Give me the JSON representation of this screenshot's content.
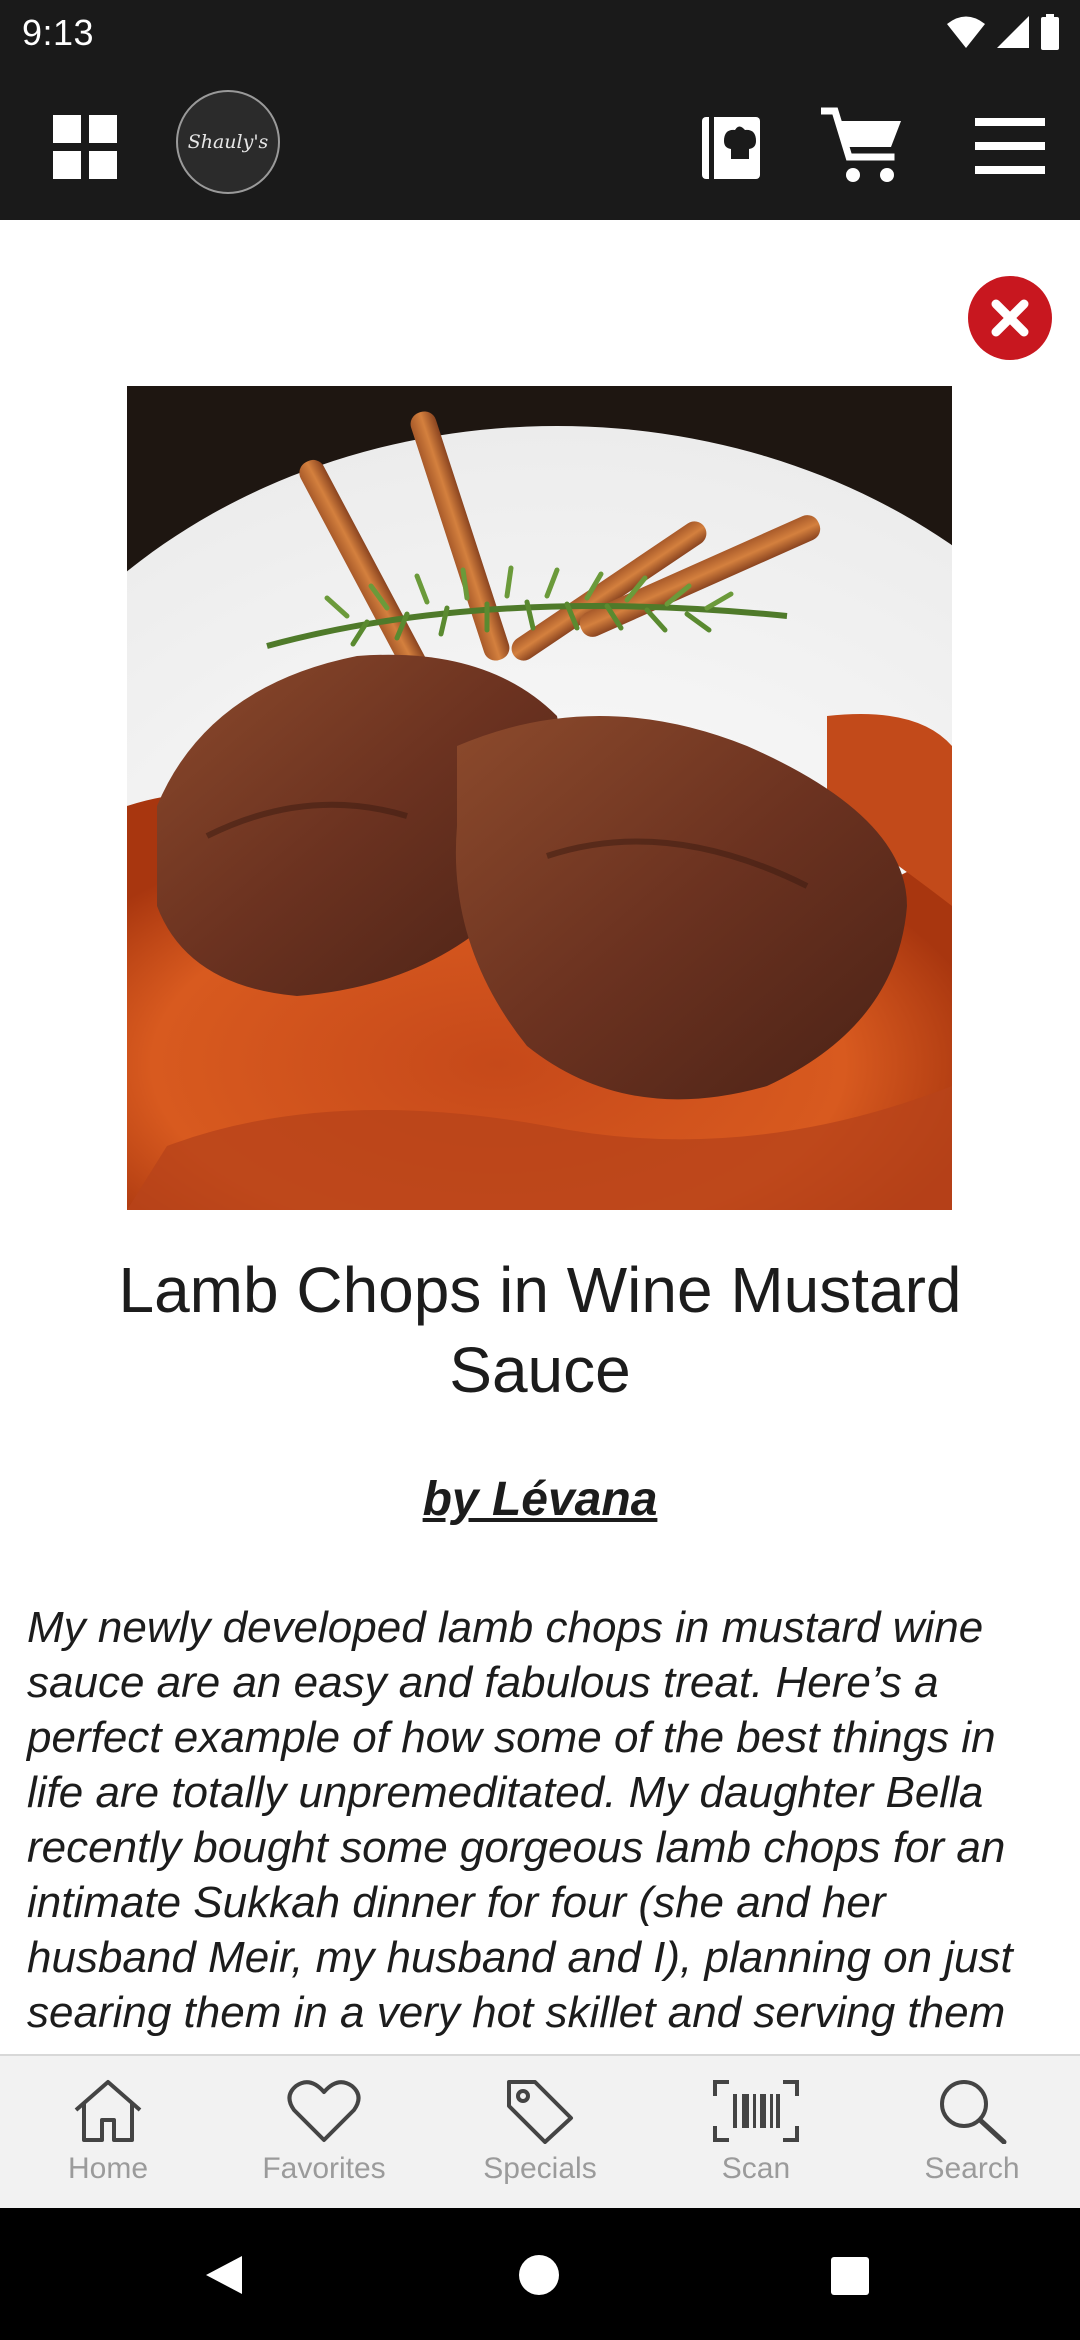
{
  "status_bar": {
    "time": "9:13",
    "icons": [
      "wifi-icon",
      "cell-signal-icon",
      "battery-icon"
    ]
  },
  "app_bar": {
    "logo_text": "Shauly's",
    "icons": [
      "grid-menu-icon",
      "recipe-book-icon",
      "cart-icon",
      "hamburger-menu-icon"
    ],
    "background": "#1a1a1a"
  },
  "recipe": {
    "title": "Lamb Chops in Wine Mustard Sauce",
    "author": "by Lévana",
    "description": "My newly developed lamb chops in mustard wine sauce are an easy and fabulous treat. Here’s a perfect example of how some of the best things in life are totally unpremeditated. My daughter Bella recently bought some gorgeous lamb chops for an intimate Sukkah dinner for four (she and her husband Meir, my husband and I), planning on just searing them in a very hot skillet and serving them",
    "close_color": "#c8171f"
  },
  "bottom_nav": {
    "items": [
      {
        "label": "Home",
        "icon": "home-icon"
      },
      {
        "label": "Favorites",
        "icon": "heart-icon"
      },
      {
        "label": "Specials",
        "icon": "tag-icon"
      },
      {
        "label": "Scan",
        "icon": "barcode-scan-icon"
      },
      {
        "label": "Search",
        "icon": "search-icon"
      }
    ],
    "label_color": "#9b9b9b"
  },
  "system_nav": {
    "icons": [
      "back-icon",
      "home-circle-icon",
      "recents-icon"
    ]
  }
}
